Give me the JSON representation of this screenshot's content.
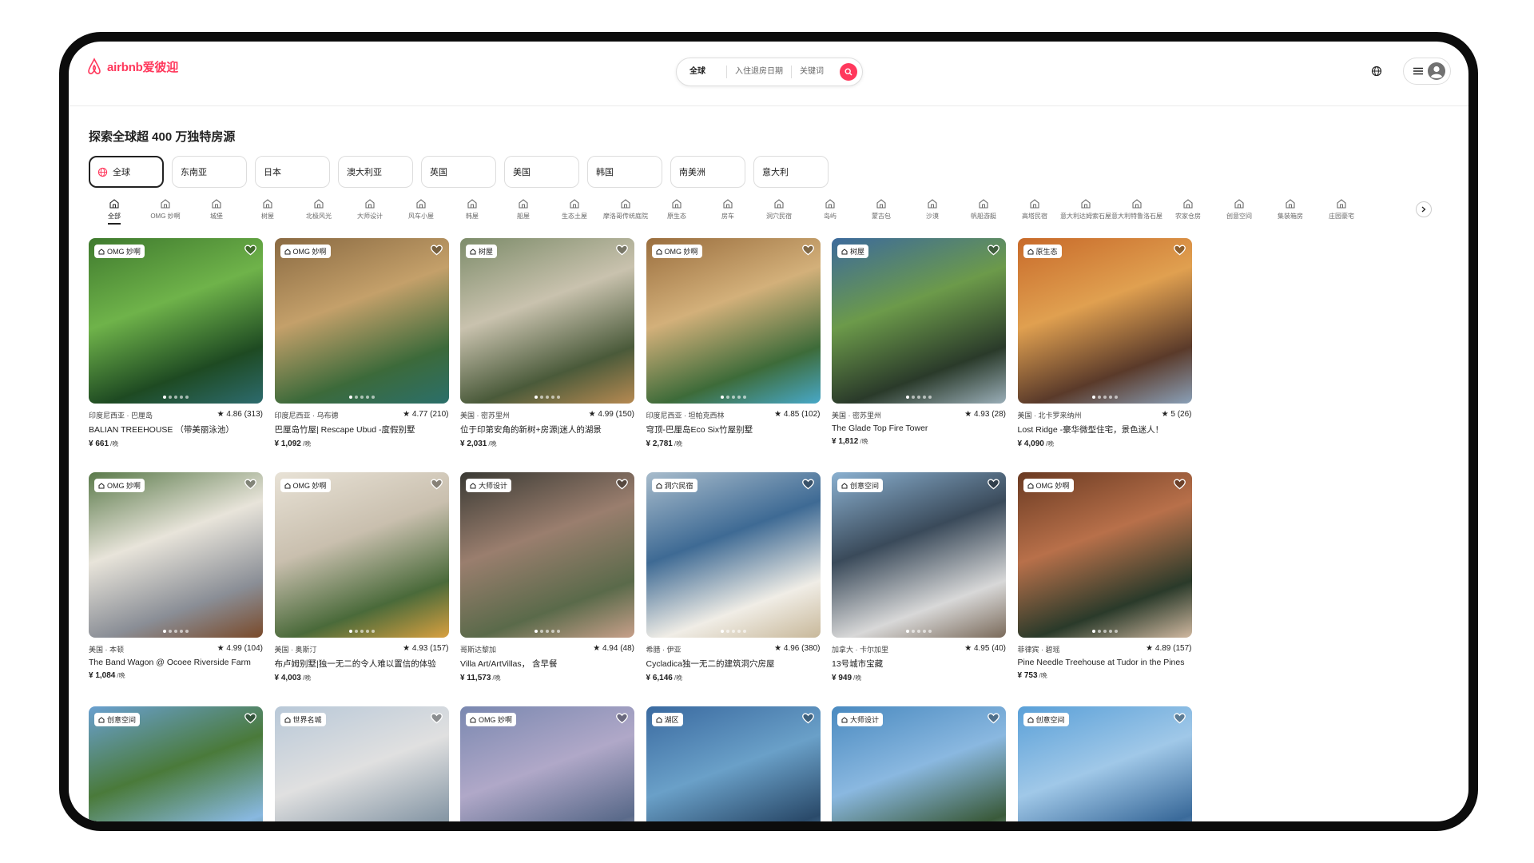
{
  "header": {
    "logo_text": "airbnb爱彼迎",
    "search": {
      "location": "全球",
      "dates": "入住退房日期",
      "keywords": "关键词"
    }
  },
  "page_title": "探索全球超 400 万独特房源",
  "regions": [
    "全球",
    "东南亚",
    "日本",
    "澳大利亚",
    "英国",
    "美国",
    "韩国",
    "南美洲",
    "意大利"
  ],
  "categories": [
    "全部",
    "OMG 妙啊",
    "城堡",
    "树屋",
    "北极风光",
    "大师设计",
    "风车小屋",
    "韩屋",
    "船屋",
    "生态土屋",
    "摩洛哥传统庭院",
    "原生态",
    "房车",
    "洞穴民宿",
    "岛屿",
    "蒙古包",
    "沙漠",
    "帆船游艇",
    "高塔民宿",
    "意大利达姆索石屋",
    "意大利特鲁洛石屋",
    "农家仓房",
    "创意空间",
    "集装箱房",
    "庄园豪宅"
  ],
  "listings": [
    {
      "badge": "OMG 妙啊",
      "location": "印度尼西亚 · 巴厘岛",
      "rating": "★ 4.86 (313)",
      "title": "BALIAN TREEHOUSE （带美丽泳池）",
      "price": "¥ 661",
      "unit": "/晚",
      "palette": [
        "#3f7a2e",
        "#6fb34a",
        "#1e4a22",
        "#2d6b6e"
      ]
    },
    {
      "badge": "OMG 妙啊",
      "location": "印度尼西亚 · 乌布德",
      "rating": "★ 4.77 (210)",
      "title": "巴厘岛竹屋| Rescape Ubud -度假别墅",
      "price": "¥ 1,092",
      "unit": "/晚",
      "palette": [
        "#8a6a42",
        "#c4a06a",
        "#3c6a3a",
        "#2b6f6a"
      ]
    },
    {
      "badge": "树屋",
      "location": "美国 · 密苏里州",
      "rating": "★ 4.99 (150)",
      "title": "位于印第安角的新树+房源|迷人的湖景",
      "price": "¥ 2,031",
      "unit": "/晚",
      "palette": [
        "#7d8c6a",
        "#c9c2ae",
        "#4a5a3a",
        "#b78a52"
      ]
    },
    {
      "badge": "OMG 妙啊",
      "location": "印度尼西亚 · 坦帕克西林",
      "rating": "★ 4.85 (102)",
      "title": "穹顶-巴厘岛Eco Six竹屋别墅",
      "price": "¥ 2,781",
      "unit": "/晚",
      "palette": [
        "#9a6e3e",
        "#d3b07a",
        "#3d6b39",
        "#48a8c8"
      ]
    },
    {
      "badge": "树屋",
      "location": "美国 · 密苏里州",
      "rating": "★ 4.93 (28)",
      "title": "The Glade Top Fire Tower",
      "price": "¥ 1,812",
      "unit": "/晚",
      "palette": [
        "#3c6a9c",
        "#6c9a4a",
        "#2a3a2a",
        "#9aaeb8"
      ]
    },
    {
      "badge": "原生态",
      "location": "美国 · 北卡罗来纳州",
      "rating": "★ 5 (26)",
      "title": "Lost Ridge -豪华微型住宅，景色迷人！",
      "price": "¥ 4,090",
      "unit": "/晚",
      "palette": [
        "#c86a2a",
        "#e0a050",
        "#5a3a2a",
        "#8aa0b8"
      ]
    },
    {
      "badge": "OMG 妙啊",
      "location": "美国 · 本顿",
      "rating": "★ 4.99 (104)",
      "title": "The Band Wagon @ Ocoee Riverside Farm",
      "price": "¥ 1,084",
      "unit": "/晚",
      "palette": [
        "#5a7a4a",
        "#e8e4da",
        "#8a8e96",
        "#7a4a2a"
      ]
    },
    {
      "badge": "OMG 妙啊",
      "location": "美国 · 奥斯汀",
      "rating": "★ 4.93 (157)",
      "title": "布卢姆别墅|独一无二的令人难以置信的体验",
      "price": "¥ 4,003",
      "unit": "/晚",
      "palette": [
        "#e8e2d6",
        "#c9bfae",
        "#4a6a3a",
        "#d8a040"
      ]
    },
    {
      "badge": "大师设计",
      "location": "哥斯达黎加",
      "rating": "★ 4.94 (48)",
      "title": "Villa Art/ArtVillas， 含早餐",
      "price": "¥ 11,573",
      "unit": "/晚",
      "palette": [
        "#3a3a34",
        "#9a7e6e",
        "#5a6a4a",
        "#c8a08a"
      ]
    },
    {
      "badge": "洞穴民宿",
      "location": "希腊 · 伊亚",
      "rating": "★ 4.96 (380)",
      "title": "Cycladica独一无二的建筑洞穴房屋",
      "price": "¥ 6,146",
      "unit": "/晚",
      "palette": [
        "#a8bccc",
        "#3e6a94",
        "#f0ede6",
        "#c8b89a"
      ]
    },
    {
      "badge": "创意空间",
      "location": "加拿大 · 卡尔加里",
      "rating": "★ 4.95 (40)",
      "title": "13号城市宝藏",
      "price": "¥ 949",
      "unit": "/晚",
      "palette": [
        "#8ab0d0",
        "#3a4a5a",
        "#d8d8d8",
        "#7a6a5a"
      ]
    },
    {
      "badge": "OMG 妙啊",
      "location": "菲律宾 · 碧瑶",
      "rating": "★ 4.89 (157)",
      "title": "Pine Needle Treehouse at Tudor in the Pines",
      "price": "¥ 753",
      "unit": "/晚",
      "palette": [
        "#6a3a22",
        "#b8704a",
        "#2a3a2a",
        "#d0b8a0"
      ]
    },
    {
      "badge": "创意空间",
      "location": "",
      "rating": "",
      "title": "",
      "price": "",
      "unit": "",
      "palette": [
        "#6aa0d0",
        "#4a7a3a",
        "#88b8e0",
        "#3a5a2a"
      ]
    },
    {
      "badge": "世界名城",
      "location": "",
      "rating": "",
      "title": "",
      "price": "",
      "unit": "",
      "palette": [
        "#b8c8d8",
        "#e0e0e0",
        "#8a9aa8",
        "#6a7a6a"
      ]
    },
    {
      "badge": "OMG 妙啊",
      "location": "",
      "rating": "",
      "title": "",
      "price": "",
      "unit": "",
      "palette": [
        "#7a88b0",
        "#b0a8c8",
        "#5a6a8a",
        "#d8c8b8"
      ]
    },
    {
      "badge": "湖区",
      "location": "",
      "rating": "",
      "title": "",
      "price": "",
      "unit": "",
      "palette": [
        "#3a6aa0",
        "#6aa0c8",
        "#2a4a6a",
        "#8ab8d8"
      ]
    },
    {
      "badge": "大师设计",
      "location": "",
      "rating": "",
      "title": "",
      "price": "",
      "unit": "",
      "palette": [
        "#4a8ac0",
        "#8ab8e0",
        "#3a5a3a",
        "#c0d0e0"
      ]
    },
    {
      "badge": "创意空间",
      "location": "",
      "rating": "",
      "title": "",
      "price": "",
      "unit": "",
      "palette": [
        "#5aa0d8",
        "#a0c8e8",
        "#3a6a9a",
        "#d0e0f0"
      ]
    }
  ]
}
